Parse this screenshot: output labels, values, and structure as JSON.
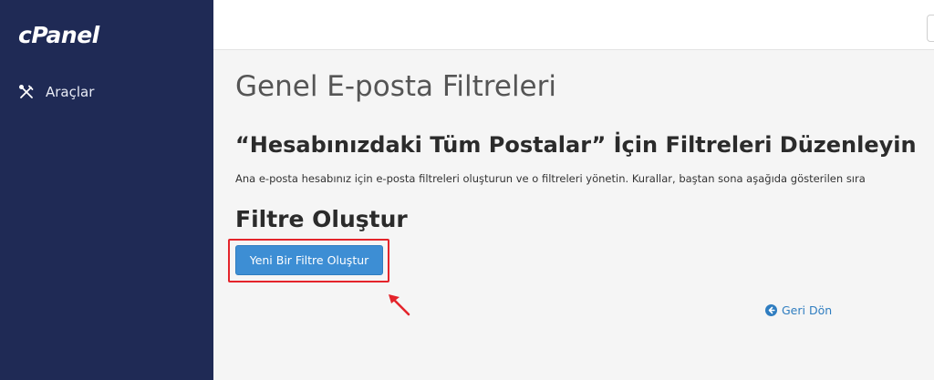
{
  "sidebar": {
    "logo": "cPanel",
    "items": [
      {
        "label": "Araçlar",
        "icon": "tools-icon"
      }
    ]
  },
  "main": {
    "page_title": "Genel E-posta Filtreleri",
    "section_heading": "“Hesabınızdaki Tüm Postalar” İçin Filtreleri Düzenleyin",
    "description": "Ana e-posta hesabınız için e-posta filtreleri oluşturun ve o filtreleri yönetin. Kurallar, baştan sona aşağıda gösterilen sıra",
    "create_heading": "Filtre Oluştur",
    "create_button_label": "Yeni Bir Filtre Oluştur",
    "back_link_label": "Geri Dön",
    "back_link_icon": "arrow-circle-left-icon"
  },
  "annotation": {
    "highlight_color": "#e4242b",
    "arrow_icon": "red-arrow-icon"
  },
  "colors": {
    "sidebar_bg": "#1f2a55",
    "primary_button": "#3d8ed4",
    "link": "#2f7dc0"
  }
}
